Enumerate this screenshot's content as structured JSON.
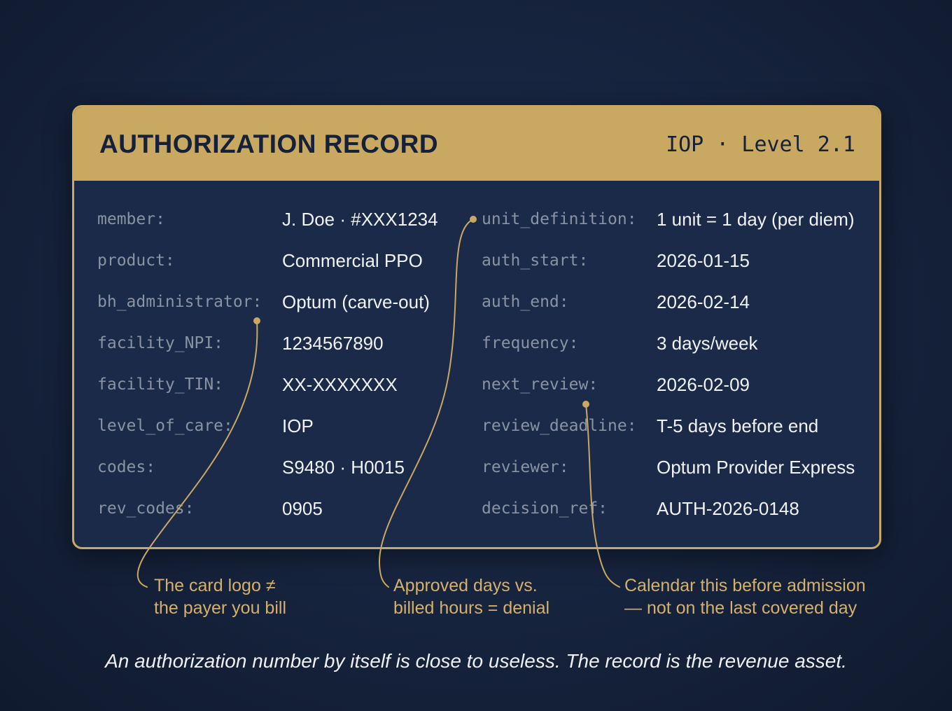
{
  "card": {
    "title": "AUTHORIZATION RECORD",
    "level": "IOP · Level 2.1",
    "left_fields": [
      {
        "label": "member:",
        "value": "J. Doe · #XXX1234"
      },
      {
        "label": "product:",
        "value": "Commercial PPO"
      },
      {
        "label": "bh_administrator:",
        "value": "Optum (carve-out)"
      },
      {
        "label": "facility_NPI:",
        "value": "1234567890"
      },
      {
        "label": "facility_TIN:",
        "value": "XX-XXXXXXX"
      },
      {
        "label": "level_of_care:",
        "value": "IOP"
      },
      {
        "label": "codes:",
        "value": "S9480 · H0015"
      },
      {
        "label": "rev_codes:",
        "value": "0905"
      }
    ],
    "right_fields": [
      {
        "label": "unit_definition:",
        "value": "1 unit = 1 day (per diem)"
      },
      {
        "label": "auth_start:",
        "value": "2026-01-15"
      },
      {
        "label": "auth_end:",
        "value": "2026-02-14"
      },
      {
        "label": "frequency:",
        "value": "3 days/week"
      },
      {
        "label": "next_review:",
        "value": "2026-02-09"
      },
      {
        "label": "review_deadline:",
        "value": "T-5 days before end"
      },
      {
        "label": "reviewer:",
        "value": "Optum Provider Express"
      },
      {
        "label": "decision_ref:",
        "value": "AUTH-2026-0148"
      }
    ]
  },
  "callouts": [
    {
      "line1": "The card logo ≠",
      "line2": "the payer you bill"
    },
    {
      "line1": "Approved days vs.",
      "line2": "billed hours = denial"
    },
    {
      "line1": "Calendar this before admission",
      "line2": "— not on the last covered day"
    }
  ],
  "footer": {
    "caption": "An authorization number by itself is close to useless. The record is the revenue asset."
  },
  "colors": {
    "background": "#16233d",
    "card_body": "#1a2a48",
    "accent_gold": "#c9a862",
    "callout_gold": "#d4b06a",
    "label_gray": "#8a93a3",
    "value_white": "#f1f2f5"
  }
}
